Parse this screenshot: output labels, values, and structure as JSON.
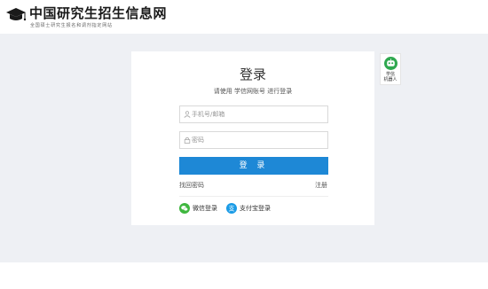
{
  "header": {
    "logo_title": "中国研究生招生信息网",
    "logo_subtitle": "全国硕士研究生报名和调剂指定网站"
  },
  "login": {
    "title": "登录",
    "subtitle": "请使用 学信网账号 进行登录",
    "username_placeholder": "手机号/邮箱",
    "password_placeholder": "密码",
    "button_label": "登 录",
    "forgot_label": "找回密码",
    "register_label": "注册",
    "wechat_label": "微信登录",
    "alipay_label": "支付宝登录",
    "alipay_icon_char": "支"
  },
  "robot": {
    "label_line1": "学信",
    "label_line2": "机器人"
  },
  "icons": {
    "logo": "graduation-cap-icon",
    "username": "user-icon",
    "password": "lock-icon",
    "wechat": "wechat-icon",
    "alipay": "alipay-icon",
    "robot": "robot-icon"
  },
  "colors": {
    "primary_button": "#1e88d6",
    "page_background": "#eef0f4",
    "wechat_green": "#3fb73f",
    "alipay_blue": "#1a9be6",
    "robot_green": "#2fa84f"
  }
}
